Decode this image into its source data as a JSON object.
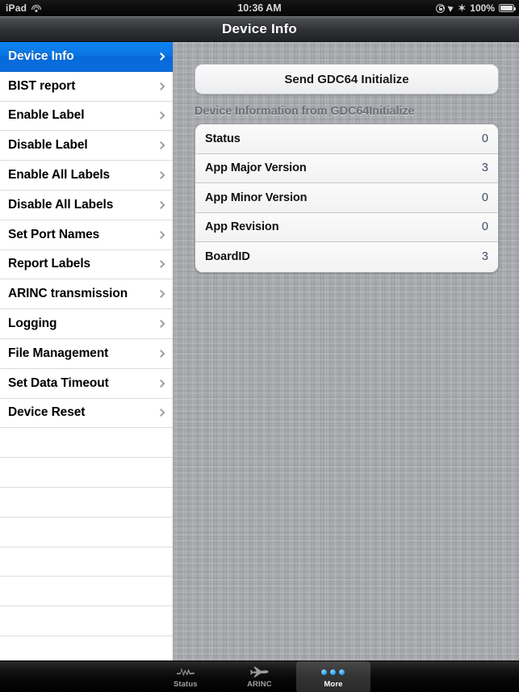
{
  "statusbar": {
    "device": "iPad",
    "wifi_icon": "wifi-icon",
    "time": "10:36 AM",
    "rotation_lock_icon": "rotation-lock-icon",
    "location_icon": "location-arrow-icon",
    "bluetooth_icon": "bluetooth-icon",
    "bluetooth_glyph": "✶",
    "battery_percent": "100%",
    "battery_icon": "battery-icon"
  },
  "navbar": {
    "title": "Device Info"
  },
  "sidebar": {
    "items": [
      {
        "label": "Device Info",
        "selected": true
      },
      {
        "label": "BIST report",
        "selected": false
      },
      {
        "label": "Enable Label",
        "selected": false
      },
      {
        "label": "Disable Label",
        "selected": false
      },
      {
        "label": "Enable All Labels",
        "selected": false
      },
      {
        "label": "Disable All Labels",
        "selected": false
      },
      {
        "label": "Set Port Names",
        "selected": false
      },
      {
        "label": "Report Labels",
        "selected": false
      },
      {
        "label": "ARINC transmission",
        "selected": false
      },
      {
        "label": "Logging",
        "selected": false
      },
      {
        "label": "File Management",
        "selected": false
      },
      {
        "label": "Set Data Timeout",
        "selected": false
      },
      {
        "label": "Device Reset",
        "selected": false
      }
    ],
    "empty_row_count": 8,
    "selected_color": "#0a74e3",
    "chevron_icon": "chevron-right-icon"
  },
  "main": {
    "action_button": {
      "label": "Send GDC64 Initialize"
    },
    "section_header": "Device Information from GDC64Initialize",
    "rows": [
      {
        "key": "Status",
        "value": "0"
      },
      {
        "key": "App Major Version",
        "value": "3"
      },
      {
        "key": "App Minor Version",
        "value": "0"
      },
      {
        "key": "App Revision",
        "value": "0"
      },
      {
        "key": "BoardID",
        "value": "3"
      }
    ],
    "value_color": "#3b4a6b"
  },
  "tabbar": {
    "tabs": [
      {
        "label": "Status",
        "icon": "waveform-bolt-icon",
        "active": false
      },
      {
        "label": "ARINC",
        "icon": "airplane-icon",
        "active": false
      },
      {
        "label": "More",
        "icon": "three-dots-icon",
        "active": true
      }
    ]
  }
}
